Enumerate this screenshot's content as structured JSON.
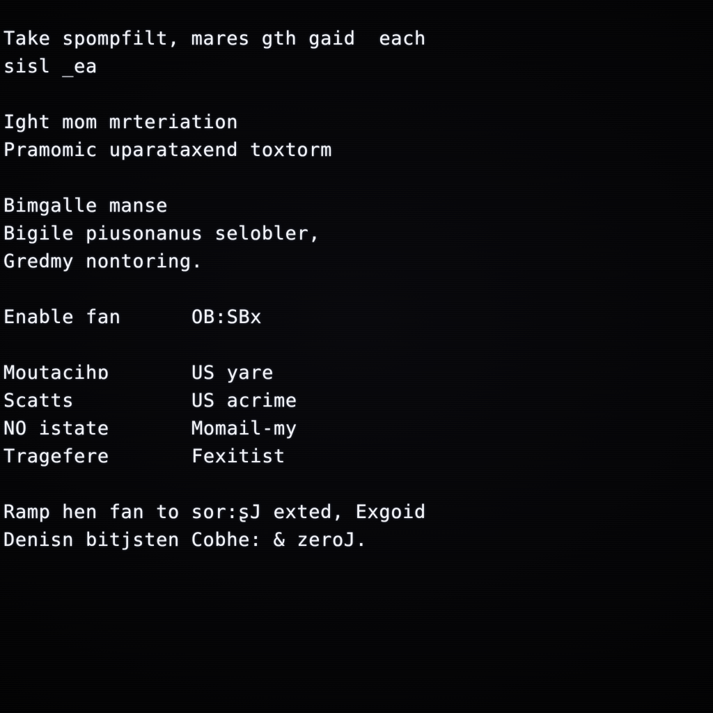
{
  "terminal": {
    "background_color": "#040406",
    "text_color": "#f2f3f7",
    "blocks": [
      {
        "id": "intro",
        "type": "paragraph",
        "lines": [
          "Take spompfilt, mares gth gaid  each",
          "sisl _ea"
        ]
      },
      {
        "id": "section-mrteriation",
        "type": "paragraph",
        "lines": [
          "Ight mom mrteriation",
          "Pramomic uparataxend toxtorm"
        ]
      },
      {
        "id": "section-bimgalle",
        "type": "paragraph",
        "lines": [
          "Bimgalle manse",
          "Bigile piusonanus selobler,",
          "Gredmy nontoring."
        ]
      },
      {
        "id": "enable-fan",
        "type": "table",
        "rows": [
          {
            "label": "Enable fan",
            "value": "OB:SBx"
          }
        ]
      },
      {
        "id": "status-table",
        "type": "table",
        "rows": [
          {
            "label": "Moutacihɒ",
            "value": "US yare"
          },
          {
            "label": "Scatts",
            "value": "US acrime"
          },
          {
            "label": "NO istate",
            "value": "Momail-my"
          },
          {
            "label": "Tragefere",
            "value": "Fexitist"
          }
        ]
      },
      {
        "id": "outro",
        "type": "paragraph",
        "lines": [
          "Ramp hen fan to sor:ʂJ exted, Exgoid",
          "Denisn bitjsten Cobhe: & zeroJ."
        ]
      }
    ]
  }
}
